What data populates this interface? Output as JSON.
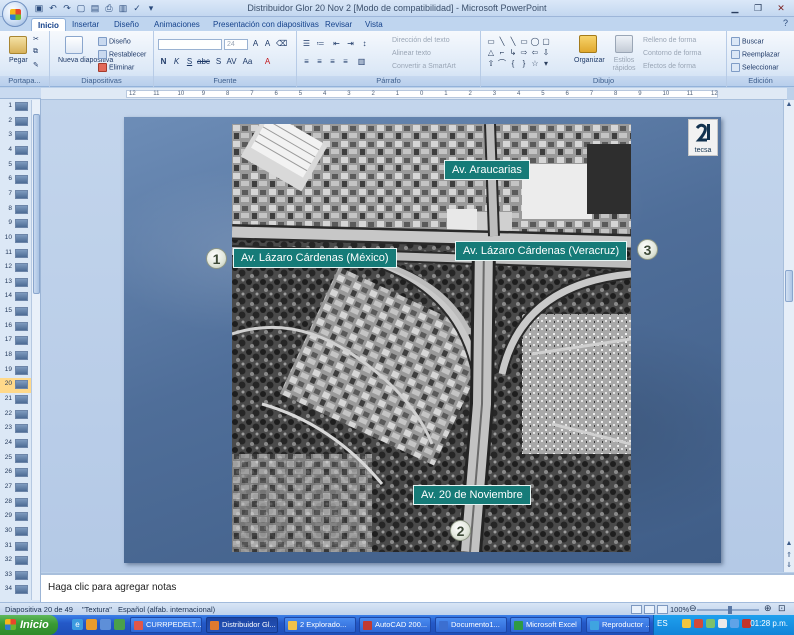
{
  "window": {
    "title": "Distribuidor Glor 20 Nov 2 [Modo de compatibilidad] - Microsoft PowerPoint"
  },
  "tabs": [
    "Inicio",
    "Insertar",
    "Diseño",
    "Animaciones",
    "Presentación con diapositivas",
    "Revisar",
    "Vista"
  ],
  "ribbon": {
    "groups": {
      "portapapeles": "Portapa...",
      "diapositivas": "Diapositivas",
      "fuente": "Fuente",
      "parrafo": "Párrafo",
      "dibujo": "Dibujo",
      "edicion": "Edición"
    },
    "pegar": "Pegar",
    "nueva_diapositiva": "Nueva diapositiva",
    "diseno": "Diseño",
    "restablecer": "Restablecer",
    "eliminar": "Eliminar",
    "font_size": "24",
    "direccion_texto": "Dirección del texto",
    "alinear_texto": "Alinear texto",
    "convertir_smartart": "Convertir a SmartArt",
    "organizar": "Organizar",
    "estilos_rapidos": "Estilos rápidos",
    "relleno_forma": "Relleno de forma",
    "contorno_forma": "Contorno de forma",
    "efectos_forma": "Efectos de forma",
    "buscar": "Buscar",
    "reemplazar": "Reemplazar",
    "seleccionar": "Seleccionar"
  },
  "ruler_numbers": [
    "12",
    "11",
    "10",
    "9",
    "8",
    "7",
    "6",
    "5",
    "4",
    "3",
    "2",
    "1",
    "0",
    "1",
    "2",
    "3",
    "4",
    "5",
    "6",
    "7",
    "8",
    "9",
    "10",
    "11",
    "12"
  ],
  "thumbnails": {
    "numbers": [
      "1",
      "2",
      "3",
      "4",
      "5",
      "6",
      "7",
      "8",
      "9",
      "10",
      "11",
      "12",
      "13",
      "14",
      "15",
      "16",
      "17",
      "18",
      "19",
      "20",
      "21",
      "22",
      "23",
      "24",
      "25",
      "26",
      "27",
      "28",
      "29",
      "30",
      "31",
      "32",
      "33",
      "34"
    ],
    "selected": "20"
  },
  "slide": {
    "labels": {
      "araucarias": "Av. Araucarias",
      "lazaro_mexico": "Av. Lázaro Cárdenas (México)",
      "lazaro_veracruz": "Av. Lázaro Cárdenas (Veracruz)",
      "noviembre": "Av. 20 de Noviembre"
    },
    "markers": [
      "1",
      "2",
      "3"
    ],
    "logo_word": "tecsa",
    "colors": {
      "label_bg": "#167b78",
      "slide_bg": "#4f6e99"
    }
  },
  "notes_placeholder": "Haga clic para agregar notas",
  "status": {
    "slide_info": "Diapositiva 20 de 49",
    "theme": "\"Textura\"",
    "language": "Español (alfab. internacional)",
    "zoom": "100%"
  },
  "taskbar": {
    "start": "Inicio",
    "tasks": [
      "CURRPEDELT...",
      "Distribuidor Gl...",
      "2 Explorado...",
      "AutoCAD 200...",
      "Documento1...",
      "Microsoft Excel",
      "Reproductor ..."
    ],
    "active_task": "Distribuidor Gl...",
    "lang": "ES",
    "clock": "01:28 p.m."
  }
}
